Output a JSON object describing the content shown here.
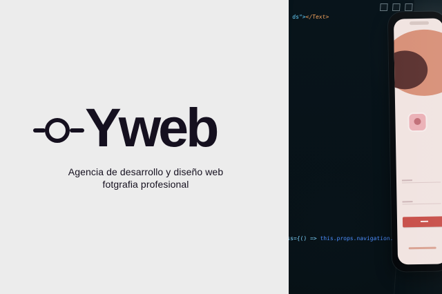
{
  "brand": {
    "name": "Yweb",
    "tagline_lines": [
      "Agencia de desarrollo y diseño web",
      "fotgrafia profesional"
    ]
  },
  "colors": {
    "left_background": "#ececec",
    "brand_dark": "#15101f",
    "code_cyan": "#68d3ff",
    "code_orange": "#f1a15c",
    "phone_accent": "#c8504a"
  },
  "photo": {
    "code_top_prefix": "ds\">",
    "code_top_accent": "</Text>",
    "code_bottom_prefix": "Press={() => ",
    "code_bottom_accent": "this.props.navigation.navigate"
  },
  "icons": {
    "logo_mark": "ring-line-logo-icon",
    "window_controls": "window-control-icon",
    "phone_device": "smartphone-mockup"
  }
}
